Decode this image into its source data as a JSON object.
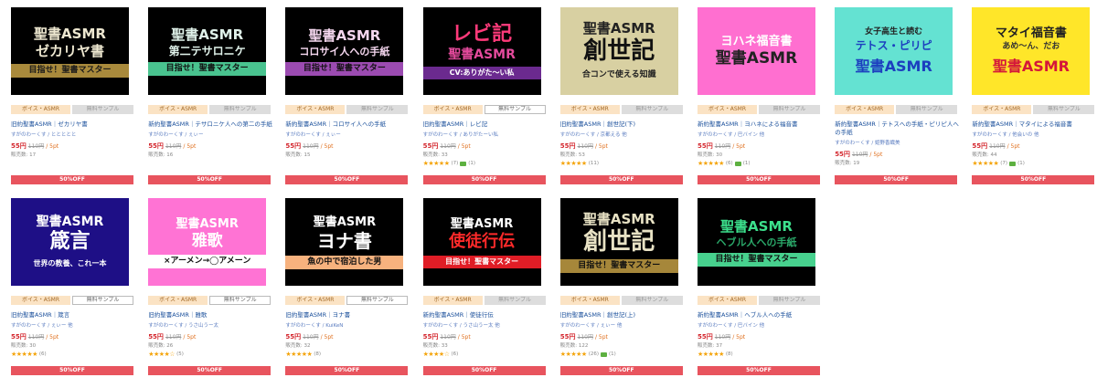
{
  "ui": {
    "genre": "ボイス・ASMR",
    "sample": "無料サンプル",
    "discount": "50%OFF"
  },
  "products": [
    {
      "col": 0,
      "row": 0,
      "t1": "聖書ASMR",
      "t2": "ゼカリヤ書",
      "t3": "目指せ！聖書マスター",
      "bg": "#000000",
      "fg": "#ede7d0",
      "fg2": "#ede7d0",
      "bar": "#a98a3c",
      "bar_fg": "#1a1a1a",
      "s1": 15,
      "s2": 15,
      "s3": 9,
      "sample_disabled": true,
      "title": "旧約聖書ASMR｜ゼカリヤ書",
      "creator": "すがのわーくす / ととととと",
      "price_now": "55円",
      "price_old": "110円",
      "points": "5pt",
      "sold": "販売数: 17",
      "stars": "",
      "rcount": "",
      "chat": false,
      "chat_count": ""
    },
    {
      "col": 1,
      "row": 0,
      "t1": "聖書ASMR",
      "t2": "第二テサロニケ",
      "t3": "目指せ！聖書マスター",
      "bg": "#000000",
      "fg": "#e0f2ea",
      "fg2": "#e0f2ea",
      "bar": "#49c38f",
      "bar_fg": "#111111",
      "s1": 15,
      "s2": 12,
      "s3": 9,
      "sample_disabled": true,
      "title": "新約聖書ASMR｜テサロニケ人への第二の手紙",
      "creator": "すがのわーくす / ぇぃー",
      "price_now": "55円",
      "price_old": "110円",
      "points": "5pt",
      "sold": "販売数: 16",
      "stars": "",
      "rcount": "",
      "chat": false,
      "chat_count": ""
    },
    {
      "col": 2,
      "row": 0,
      "t1": "聖書ASMR",
      "t2": "コロサイ人への手紙",
      "t3": "目指せ！聖書マスター",
      "bg": "#000000",
      "fg": "#f5d7ef",
      "fg2": "#f5d7ef",
      "bar": "#9b4bb1",
      "bar_fg": "#111111",
      "s1": 15,
      "s2": 11,
      "s3": 9,
      "sample_disabled": true,
      "title": "新約聖書ASMR｜コロサイ人への手紙",
      "creator": "すがのわーくす / ぇぃー",
      "price_now": "55円",
      "price_old": "110円",
      "points": "5pt",
      "sold": "販売数: 15",
      "stars": "",
      "rcount": "",
      "chat": false,
      "chat_count": ""
    },
    {
      "col": 3,
      "row": 0,
      "t1": "レビ記",
      "t2": "聖書ASMR",
      "t3": "CV:ありがた〜い私",
      "bg": "#000000",
      "fg": "#ff3a7a",
      "fg2": "#e44a9c",
      "bar": "#6b2a8f",
      "bar_fg": "#ffffff",
      "s1": 22,
      "s2": 14,
      "s3": 8,
      "sample_disabled": false,
      "title": "旧約聖書ASMR｜レビ記",
      "creator": "すがのわーくす / ありがたーい私",
      "price_now": "55円",
      "price_old": "110円",
      "points": "5pt",
      "sold": "販売数: 33",
      "stars": "★★★★★",
      "rcount": "(7)",
      "chat": true,
      "chat_count": "(1)"
    },
    {
      "col": 4,
      "row": 0,
      "t1": "聖書ASMR",
      "t2": "創世記",
      "t3": "合コンで使える知識",
      "bg": "#d8d0a2",
      "fg": "#222222",
      "fg2": "#111111",
      "bar": "#d8d0a2",
      "bar_fg": "#222222",
      "s1": 15,
      "s2": 26,
      "s3": 9,
      "sample_disabled": true,
      "title": "旧約聖書ASMR｜創世記(下)",
      "creator": "すがのわーくす / 京都える 他",
      "price_now": "55円",
      "price_old": "110円",
      "points": "5pt",
      "sold": "販売数: 53",
      "stars": "★★★★★",
      "rcount": "(11)",
      "chat": false,
      "chat_count": ""
    },
    {
      "col": 5,
      "row": 0,
      "t1": "ヨハネ福音書",
      "t2": "聖書ASMR",
      "t3": "",
      "bg": "#ff6fd0",
      "fg": "#ffffff",
      "fg2": "#222222",
      "bar": "#ffffff",
      "bar_fg": "#222222",
      "s1": 13,
      "s2": 17,
      "s3": 8,
      "sample_disabled": true,
      "title": "新約聖書ASMR｜ヨハネによる福音書",
      "creator": "すがのわーくす / 巴バイン 他",
      "price_now": "55円",
      "price_old": "110円",
      "points": "5pt",
      "sold": "販売数: 30",
      "stars": "★★★★★",
      "rcount": "(6)",
      "chat": true,
      "chat_count": "(1)"
    },
    {
      "col": 6,
      "row": 0,
      "t1": "女子高生と読む",
      "t2": "テトス・ピリピ",
      "t3": "聖書ASMR",
      "bg": "#64e2d2",
      "fg": "#222222",
      "fg2": "#1c3fbf",
      "bar": "#64e2d2",
      "bar_fg": "#1c3fbf",
      "s1": 9,
      "s2": 12,
      "s3": 16,
      "sample_disabled": true,
      "title": "新約聖書ASMR｜テトスへの手紙・ピリピ人への手紙",
      "creator": "すがのわーくす / 姫野香織美",
      "price_now": "55円",
      "price_old": "110円",
      "points": "5pt",
      "sold": "販売数: 19",
      "stars": "",
      "rcount": "",
      "chat": false,
      "chat_count": ""
    },
    {
      "col": 7,
      "row": 0,
      "t1": "マタイ福音書",
      "t2": "あめ〜ん、だお",
      "t3": "聖書ASMR",
      "bg": "#ffe629",
      "fg": "#222222",
      "fg2": "#333333",
      "bar": "#ffe629",
      "bar_fg": "#d4173a",
      "s1": 13,
      "s2": 9,
      "s3": 16,
      "sample_disabled": true,
      "title": "新約聖書ASMR｜マタイによる福音書",
      "creator": "すがのわーくす / 他会いの 他",
      "price_now": "55円",
      "price_old": "110円",
      "points": "5pt",
      "sold": "販売数: 44",
      "stars": "★★★★★",
      "rcount": "(7)",
      "chat": true,
      "chat_count": "(1)"
    },
    {
      "col": 0,
      "row": 1,
      "t1": "聖書ASMR",
      "t2": "箴言",
      "t3": "世界の教養、これ一本",
      "bg": "#1e0f86",
      "fg": "#ffffff",
      "fg2": "#ffffff",
      "bar": "#1e0f86",
      "bar_fg": "#ffffff",
      "s1": 14,
      "s2": 22,
      "s3": 8,
      "sample_disabled": false,
      "title": "旧約聖書ASMR｜箴言",
      "creator": "すがのわーくす / ぇぃー 他",
      "price_now": "55円",
      "price_old": "110円",
      "points": "5pt",
      "sold": "販売数: 30",
      "stars": "★★★★★",
      "rcount": "(6)",
      "chat": false,
      "chat_count": ""
    },
    {
      "col": 1,
      "row": 1,
      "t1": "聖書ASMR",
      "t2": "雅歌",
      "t3": "×アーメン→◯アメーン",
      "bg": "#ff73d4",
      "fg": "#ffffff",
      "fg2": "#ffffff",
      "bar": "#ffffff",
      "bar_fg": "#111111",
      "s1": 13,
      "s2": 17,
      "s3": 9,
      "sample_disabled": false,
      "title": "旧約聖書ASMR｜雅歌",
      "creator": "すがのわーくす / うさ山うー太",
      "price_now": "55円",
      "price_old": "110円",
      "points": "5pt",
      "sold": "販売数: 26",
      "stars": "★★★★☆",
      "rcount": "(5)",
      "chat": false,
      "chat_count": ""
    },
    {
      "col": 2,
      "row": 1,
      "t1": "聖書ASMR",
      "t2": "ヨナ書",
      "t3": "魚の中で宿泊した男",
      "bg": "#000000",
      "fg": "#ffffff",
      "fg2": "#ffffff",
      "bar": "#f7b27e",
      "bar_fg": "#111111",
      "s1": 13,
      "s2": 20,
      "s3": 9,
      "sample_disabled": false,
      "title": "旧約聖書ASMR｜ヨナ書",
      "creator": "すがのわーくす / KuiKeN",
      "price_now": "55円",
      "price_old": "110円",
      "points": "5pt",
      "sold": "販売数: 32",
      "stars": "★★★★★",
      "rcount": "(8)",
      "chat": false,
      "chat_count": ""
    },
    {
      "col": 3,
      "row": 1,
      "t1": "聖書ASMR",
      "t2": "使徒行伝",
      "t3": "目指せ！聖書マスター",
      "bg": "#000000",
      "fg": "#ffffff",
      "fg2": "#ff2a2a",
      "bar": "#e01d26",
      "bar_fg": "#ffffff",
      "s1": 13,
      "s2": 18,
      "s3": 8,
      "sample_disabled": true,
      "title": "新約聖書ASMR｜使徒行伝",
      "creator": "すがのわーくす / うさ山うー太 他",
      "price_now": "55円",
      "price_old": "110円",
      "points": "5pt",
      "sold": "販売数: 33",
      "stars": "★★★★☆",
      "rcount": "(6)",
      "chat": false,
      "chat_count": ""
    },
    {
      "col": 4,
      "row": 1,
      "t1": "聖書ASMR",
      "t2": "創世記",
      "t3": "目指せ！聖書マスター",
      "bg": "#000000",
      "fg": "#e8e2c4",
      "fg2": "#e8e2c4",
      "bar": "#a6873a",
      "bar_fg": "#111111",
      "s1": 15,
      "s2": 26,
      "s3": 9,
      "sample_disabled": true,
      "title": "旧約聖書ASMR｜創世記(上)",
      "creator": "すがのわーくす / ぇぃー 他",
      "price_now": "55円",
      "price_old": "110円",
      "points": "5pt",
      "sold": "販売数: 122",
      "stars": "★★★★★",
      "rcount": "(26)",
      "chat": true,
      "chat_count": "(1)"
    },
    {
      "col": 5,
      "row": 1,
      "t1": "聖書ASMR",
      "t2": "ヘブル人への手紙",
      "t3": "目指せ！聖書マスター",
      "bg": "#000000",
      "fg": "#3ce08c",
      "fg2": "#2aa869",
      "bar": "#47d18e",
      "bar_fg": "#111111",
      "s1": 15,
      "s2": 11,
      "s3": 9,
      "sample_disabled": true,
      "title": "新約聖書ASMR｜ヘブル人への手紙",
      "creator": "すがのわーくす / 巴バイン 他",
      "price_now": "55円",
      "price_old": "110円",
      "points": "5pt",
      "sold": "販売数: 37",
      "stars": "★★★★★",
      "rcount": "(8)",
      "chat": false,
      "chat_count": ""
    }
  ]
}
